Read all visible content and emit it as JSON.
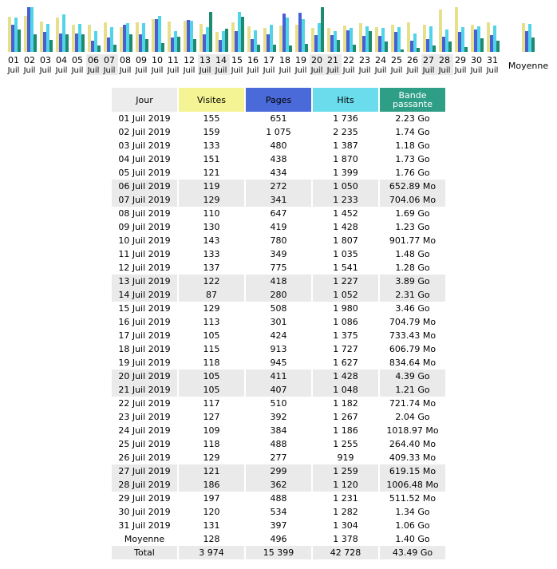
{
  "colors": {
    "visits": "#e6e08c",
    "pages": "#4a5fd4",
    "hits": "#52d4e8",
    "bandwidth": "#1f8a70",
    "weekend": "#eaeaea"
  },
  "chart_data": {
    "type": "bar",
    "categories": [
      "01",
      "02",
      "03",
      "04",
      "05",
      "06",
      "07",
      "08",
      "09",
      "10",
      "11",
      "12",
      "13",
      "14",
      "15",
      "16",
      "17",
      "18",
      "19",
      "20",
      "21",
      "22",
      "23",
      "24",
      "25",
      "26",
      "27",
      "28",
      "29",
      "30",
      "31"
    ],
    "month_label": "Juil",
    "weekend_days": [
      "06",
      "07",
      "13",
      "14",
      "20",
      "21",
      "27",
      "28"
    ],
    "average_label": "Moyenne",
    "series": [
      {
        "key": "visits",
        "values": [
          155,
          159,
          133,
          151,
          121,
          119,
          129,
          110,
          130,
          143,
          133,
          137,
          122,
          87,
          129,
          113,
          105,
          115,
          118,
          105,
          105,
          117,
          127,
          109,
          118,
          129,
          121,
          186,
          197,
          120,
          131
        ],
        "average": 128
      },
      {
        "key": "pages",
        "values": [
          651,
          1075,
          480,
          438,
          434,
          272,
          341,
          647,
          419,
          780,
          349,
          775,
          418,
          280,
          508,
          301,
          424,
          913,
          945,
          411,
          407,
          510,
          392,
          384,
          488,
          277,
          299,
          362,
          488,
          534,
          397
        ],
        "average": 496
      },
      {
        "key": "hits",
        "values": [
          1736,
          2235,
          1387,
          1870,
          1399,
          1050,
          1233,
          1452,
          1428,
          1807,
          1035,
          1541,
          1227,
          1052,
          1980,
          1086,
          1375,
          1727,
          1627,
          1428,
          1048,
          1182,
          1267,
          1186,
          1255,
          919,
          1259,
          1120,
          1231,
          1282,
          1304
        ],
        "average": 1378
      },
      {
        "key": "bandwidth_mo",
        "values": [
          2283.5,
          1781.8,
          1208.3,
          1771.5,
          1802.2,
          652.89,
          704.06,
          1730.6,
          1259.5,
          901.77,
          1515.5,
          1310.7,
          3983.4,
          2365.4,
          3543.0,
          704.79,
          733.43,
          606.79,
          834.64,
          4495.4,
          1239.0,
          721.74,
          2089.0,
          1018.97,
          264.4,
          409.33,
          619.15,
          1006.48,
          511.52,
          1372.2,
          1085.4
        ],
        "average": 1433.6
      }
    ]
  },
  "table": {
    "headers": {
      "day": "Jour",
      "visits": "Visites",
      "pages": "Pages",
      "hits": "Hits",
      "bandwidth": "Bande passante"
    },
    "rows": [
      [
        "01 Juil 2019",
        "155",
        "651",
        "1 736",
        "2.23 Go"
      ],
      [
        "02 Juil 2019",
        "159",
        "1 075",
        "2 235",
        "1.74 Go"
      ],
      [
        "03 Juil 2019",
        "133",
        "480",
        "1 387",
        "1.18 Go"
      ],
      [
        "04 Juil 2019",
        "151",
        "438",
        "1 870",
        "1.73 Go"
      ],
      [
        "05 Juil 2019",
        "121",
        "434",
        "1 399",
        "1.76 Go"
      ],
      [
        "06 Juil 2019",
        "119",
        "272",
        "1 050",
        "652.89 Mo"
      ],
      [
        "07 Juil 2019",
        "129",
        "341",
        "1 233",
        "704.06 Mo"
      ],
      [
        "08 Juil 2019",
        "110",
        "647",
        "1 452",
        "1.69 Go"
      ],
      [
        "09 Juil 2019",
        "130",
        "419",
        "1 428",
        "1.23 Go"
      ],
      [
        "10 Juil 2019",
        "143",
        "780",
        "1 807",
        "901.77 Mo"
      ],
      [
        "11 Juil 2019",
        "133",
        "349",
        "1 035",
        "1.48 Go"
      ],
      [
        "12 Juil 2019",
        "137",
        "775",
        "1 541",
        "1.28 Go"
      ],
      [
        "13 Juil 2019",
        "122",
        "418",
        "1 227",
        "3.89 Go"
      ],
      [
        "14 Juil 2019",
        "87",
        "280",
        "1 052",
        "2.31 Go"
      ],
      [
        "15 Juil 2019",
        "129",
        "508",
        "1 980",
        "3.46 Go"
      ],
      [
        "16 Juil 2019",
        "113",
        "301",
        "1 086",
        "704.79 Mo"
      ],
      [
        "17 Juil 2019",
        "105",
        "424",
        "1 375",
        "733.43 Mo"
      ],
      [
        "18 Juil 2019",
        "115",
        "913",
        "1 727",
        "606.79 Mo"
      ],
      [
        "19 Juil 2019",
        "118",
        "945",
        "1 627",
        "834.64 Mo"
      ],
      [
        "20 Juil 2019",
        "105",
        "411",
        "1 428",
        "4.39 Go"
      ],
      [
        "21 Juil 2019",
        "105",
        "407",
        "1 048",
        "1.21 Go"
      ],
      [
        "22 Juil 2019",
        "117",
        "510",
        "1 182",
        "721.74 Mo"
      ],
      [
        "23 Juil 2019",
        "127",
        "392",
        "1 267",
        "2.04 Go"
      ],
      [
        "24 Juil 2019",
        "109",
        "384",
        "1 186",
        "1018.97 Mo"
      ],
      [
        "25 Juil 2019",
        "118",
        "488",
        "1 255",
        "264.40 Mo"
      ],
      [
        "26 Juil 2019",
        "129",
        "277",
        "919",
        "409.33 Mo"
      ],
      [
        "27 Juil 2019",
        "121",
        "299",
        "1 259",
        "619.15 Mo"
      ],
      [
        "28 Juil 2019",
        "186",
        "362",
        "1 120",
        "1006.48 Mo"
      ],
      [
        "29 Juil 2019",
        "197",
        "488",
        "1 231",
        "511.52 Mo"
      ],
      [
        "30 Juil 2019",
        "120",
        "534",
        "1 282",
        "1.34 Go"
      ],
      [
        "31 Juil 2019",
        "131",
        "397",
        "1 304",
        "1.06 Go"
      ]
    ],
    "average": [
      "Moyenne",
      "128",
      "496",
      "1 378",
      "1.40 Go"
    ],
    "total": [
      "Total",
      "3 974",
      "15 399",
      "42 728",
      "43.49 Go"
    ]
  }
}
